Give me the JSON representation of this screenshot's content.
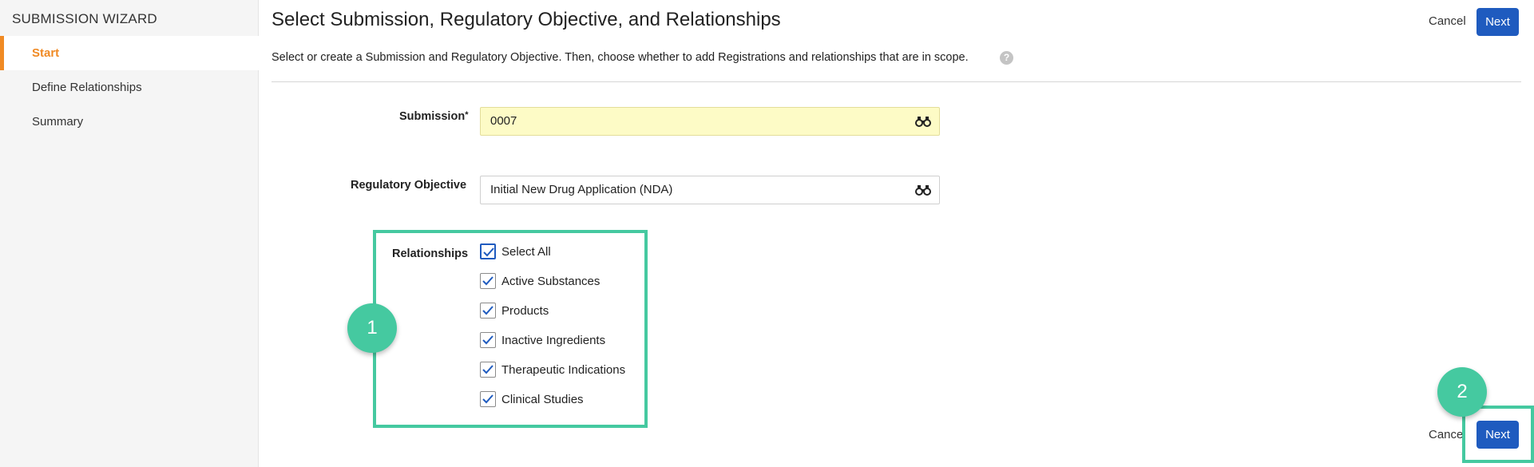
{
  "sidebar": {
    "title": "SUBMISSION WIZARD",
    "items": [
      {
        "label": "Start",
        "active": true
      },
      {
        "label": "Define Relationships",
        "active": false
      },
      {
        "label": "Summary",
        "active": false
      }
    ]
  },
  "header": {
    "title": "Select Submission, Regulatory Objective, and Relationships",
    "cancel_label": "Cancel",
    "next_label": "Next",
    "subtitle": "Select or create a Submission and Regulatory Objective. Then, choose whether to add Registrations and relationships that are in scope.",
    "help_glyph": "?"
  },
  "form": {
    "submission": {
      "label": "Submission",
      "required_mark": "*",
      "value": "0007",
      "icon": "binoculars-icon"
    },
    "regulatory_objective": {
      "label": "Regulatory Objective",
      "value": "Initial New Drug Application (NDA)",
      "icon": "binoculars-icon"
    },
    "relationships": {
      "label": "Relationships",
      "options": [
        {
          "label": "Select All",
          "checked": true
        },
        {
          "label": "Active Substances",
          "checked": true
        },
        {
          "label": "Products",
          "checked": true
        },
        {
          "label": "Inactive Ingredients",
          "checked": true
        },
        {
          "label": "Therapeutic Indications",
          "checked": true
        },
        {
          "label": "Clinical Studies",
          "checked": true
        }
      ]
    }
  },
  "footer": {
    "cancel_label": "Cance",
    "next_label": "Next"
  },
  "callouts": [
    {
      "number": "1"
    },
    {
      "number": "2"
    }
  ],
  "colors": {
    "accent": "#f08a24",
    "primary_button": "#1f5bbf",
    "callout": "#45c9a0",
    "highlight_field": "#fdfbc6"
  }
}
